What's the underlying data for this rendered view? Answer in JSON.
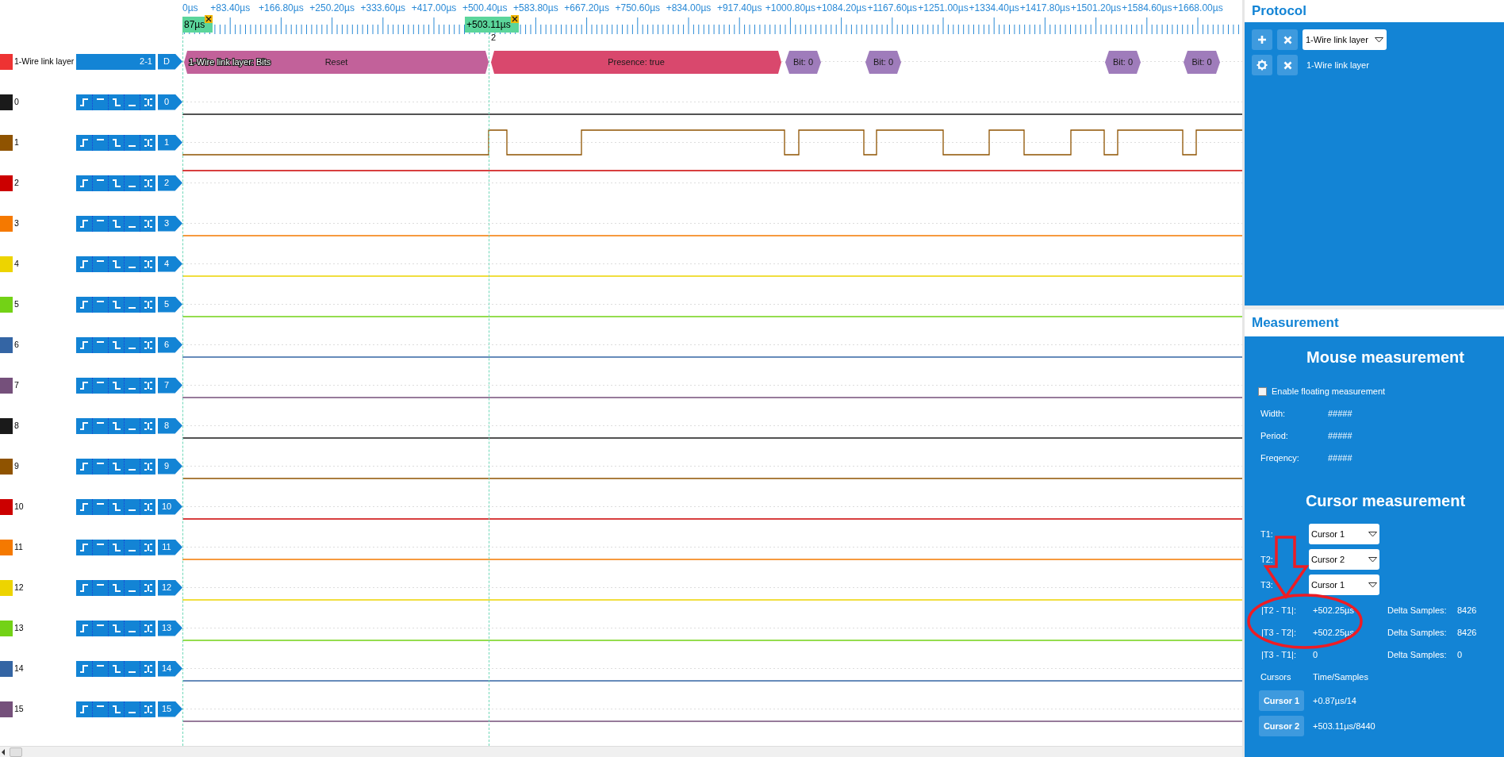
{
  "ruler": {
    "labels": [
      "0µs",
      "+83.40µs",
      "+166.80µs",
      "+250.20µs",
      "+333.60µs",
      "+417.00µs",
      "+500.40µs",
      "+583.80µs",
      "+667.20µs",
      "+750.60µs",
      "+834.00µs",
      "+917.40µs",
      "+1000.80µs",
      "+1084.20µs",
      "+1167.60µs",
      "+1251.00µs",
      "+1334.40µs",
      "+1417.80µs",
      "+1501.20µs",
      "+1584.60µs",
      "+1668.00µs"
    ]
  },
  "cursors": [
    {
      "flag": "87µs"
    },
    {
      "flag": "+503.11µs",
      "number": "2"
    }
  ],
  "protocol_track": {
    "name": "1-Wire link layer",
    "color": "#ee3333",
    "range": "2-1",
    "tag": "D",
    "layer_label": "1-Wire link layer: Bits",
    "frames": [
      {
        "kind": "reset",
        "label": "Reset"
      },
      {
        "kind": "presence",
        "label": "Presence: true"
      },
      {
        "kind": "bit",
        "label": "Bit: 0"
      },
      {
        "kind": "bit",
        "label": "Bit: 0"
      },
      {
        "kind": "bit",
        "label": "Bit: 0"
      },
      {
        "kind": "bit",
        "label": "Bit: 0"
      }
    ]
  },
  "channels": [
    {
      "name": "0",
      "tag": "0",
      "color": "#1a1a1a",
      "kind": "flat",
      "high": false
    },
    {
      "name": "1",
      "tag": "1",
      "color": "#8f5300",
      "kind": "pulses",
      "high": false
    },
    {
      "name": "2",
      "tag": "2",
      "color": "#cc0000",
      "kind": "flat",
      "high": true
    },
    {
      "name": "3",
      "tag": "3",
      "color": "#f57900",
      "kind": "flat",
      "high": false
    },
    {
      "name": "4",
      "tag": "4",
      "color": "#edd400",
      "kind": "flat",
      "high": false
    },
    {
      "name": "5",
      "tag": "5",
      "color": "#73d216",
      "kind": "flat",
      "high": false
    },
    {
      "name": "6",
      "tag": "6",
      "color": "#3465a4",
      "kind": "flat",
      "high": false
    },
    {
      "name": "7",
      "tag": "7",
      "color": "#75507b",
      "kind": "flat",
      "high": false
    },
    {
      "name": "8",
      "tag": "8",
      "color": "#1a1a1a",
      "kind": "flat",
      "high": false
    },
    {
      "name": "9",
      "tag": "9",
      "color": "#8f5300",
      "kind": "flat",
      "high": false
    },
    {
      "name": "10",
      "tag": "10",
      "color": "#cc0000",
      "kind": "flat",
      "high": false
    },
    {
      "name": "11",
      "tag": "11",
      "color": "#f57900",
      "kind": "flat",
      "high": false
    },
    {
      "name": "12",
      "tag": "12",
      "color": "#edd400",
      "kind": "flat",
      "high": false
    },
    {
      "name": "13",
      "tag": "13",
      "color": "#73d216",
      "kind": "flat",
      "high": false
    },
    {
      "name": "14",
      "tag": "14",
      "color": "#3465a4",
      "kind": "flat",
      "high": false
    },
    {
      "name": "15",
      "tag": "15",
      "color": "#75507b",
      "kind": "flat",
      "high": false
    }
  ],
  "protocol_panel": {
    "title": "Protocol",
    "selector": "1-Wire link layer",
    "layers": [
      {
        "name": "1-Wire link layer"
      }
    ]
  },
  "measurement": {
    "title": "Measurement",
    "mouse": {
      "title": "Mouse measurement",
      "floating": {
        "label": "Enable floating measurement",
        "checked": false
      },
      "rows": [
        {
          "label": "Width:",
          "value": "#####"
        },
        {
          "label": "Period:",
          "value": "#####"
        },
        {
          "label": "Freqency:",
          "value": "#####"
        }
      ]
    },
    "cursor": {
      "title": "Cursor measurement",
      "selects": [
        {
          "label": "T1:",
          "value": "Cursor 1"
        },
        {
          "label": "T2:",
          "value": "Cursor 2"
        },
        {
          "label": "T3:",
          "value": "Cursor 1"
        }
      ],
      "deltas": [
        {
          "label": "|T2 - T1|:",
          "value": "+502.25µs",
          "samples_label": "Delta Samples:",
          "samples": "8426"
        },
        {
          "label": "|T3 - T2|:",
          "value": "+502.25µs",
          "samples_label": "Delta Samples:",
          "samples": "8426"
        },
        {
          "label": "|T3 - T1|:",
          "value": "0",
          "samples_label": "Delta Samples:",
          "samples": "0"
        }
      ],
      "table_header": [
        "Cursors",
        "Time/Samples"
      ],
      "cursors": [
        {
          "label": "Cursor 1",
          "value": "+0.87µs/14"
        },
        {
          "label": "Cursor 2",
          "value": "+503.11µs/8440"
        }
      ]
    }
  }
}
